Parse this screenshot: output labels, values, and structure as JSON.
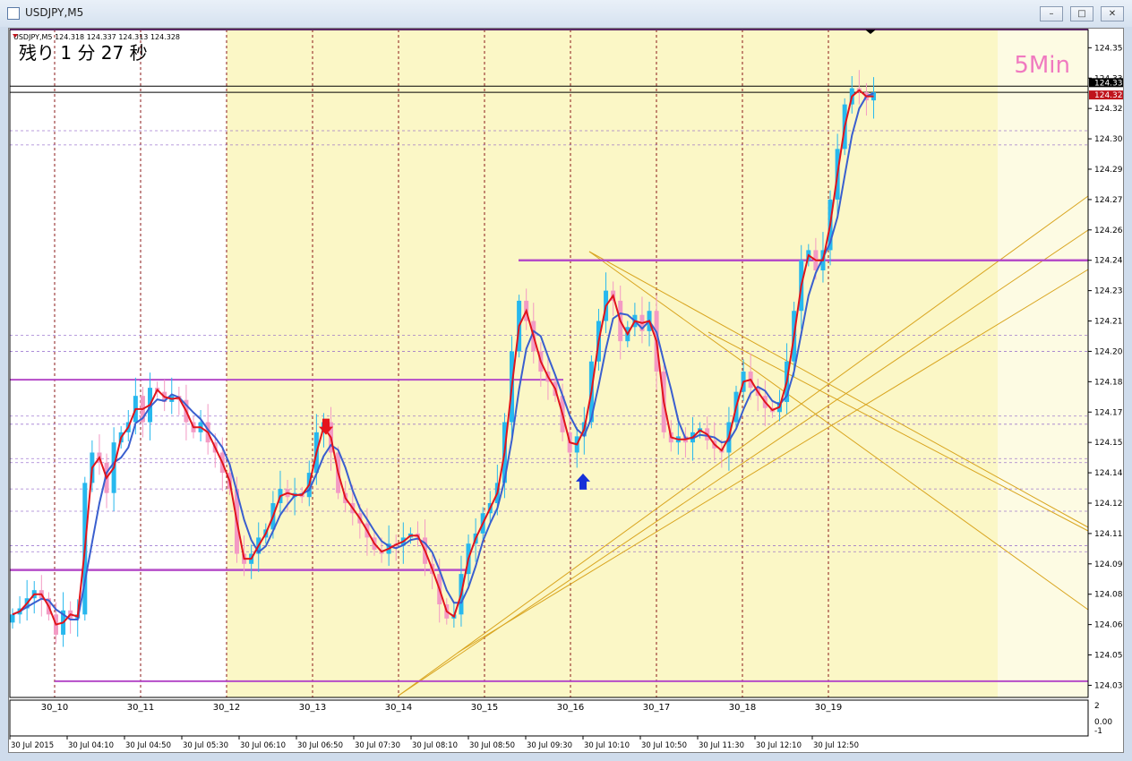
{
  "window": {
    "title": "USDJPY,M5",
    "buttons": [
      "minimize",
      "restore",
      "close"
    ]
  },
  "info_line": "USDJPY,M5  124.318 124.337 124.313 124.328",
  "countdown": "残り 1 分 27 秒",
  "timeframe_label": "5Min",
  "colors": {
    "bg_shade": "#fbf7c6",
    "bull_candle": "#27b8ee",
    "bear_candle": "#f39ac4",
    "ma_fast": "#e0141c",
    "ma_slow": "#3a5fcf",
    "level": "#b54cc8",
    "trend": "#d9a520",
    "grid": "#8b1a1a",
    "price_tag": "#c0141c"
  },
  "chart_data": {
    "type": "candlestick",
    "symbol": "USDJPY",
    "timeframe": "M5",
    "ylim": [
      124.029,
      124.359
    ],
    "y_ticks": [
      "124.350",
      "124.335",
      "124.320",
      "124.305",
      "124.290",
      "124.275",
      "124.260",
      "124.245",
      "124.230",
      "124.215",
      "124.200",
      "124.185",
      "124.170",
      "124.155",
      "124.140",
      "124.125",
      "124.110",
      "124.095",
      "124.080",
      "124.065",
      "124.050",
      "124.035"
    ],
    "price_tags": [
      "124.331",
      "124.328"
    ],
    "day_labels": [
      "30_10",
      "30_11",
      "30_12",
      "30_13",
      "30_14",
      "30_15",
      "30_16",
      "30_17",
      "30_18",
      "30_19"
    ],
    "time_labels": [
      "30 Jul 2015",
      "30 Jul 04:10",
      "30 Jul 04:50",
      "30 Jul 05:30",
      "30 Jul 06:10",
      "30 Jul 06:50",
      "30 Jul 07:30",
      "30 Jul 08:10",
      "30 Jul 08:50",
      "30 Jul 09:30",
      "30 Jul 10:10",
      "30 Jul 10:50",
      "30 Jul 11:30",
      "30 Jul 12:10",
      "30 Jul 12:50"
    ],
    "sub_ticks": [
      "2",
      "0.00",
      "-1"
    ],
    "close_series": [
      124.07,
      124.073,
      124.078,
      124.082,
      124.078,
      124.07,
      124.06,
      124.072,
      124.068,
      124.07,
      124.135,
      124.15,
      124.145,
      124.13,
      124.155,
      124.16,
      124.165,
      124.178,
      124.165,
      124.182,
      124.18,
      124.175,
      124.178,
      124.176,
      124.165,
      124.16,
      124.165,
      124.155,
      124.15,
      124.14,
      124.132,
      124.1,
      124.095,
      124.1,
      124.108,
      124.112,
      124.125,
      124.132,
      124.128,
      124.13,
      124.128,
      124.14,
      124.16,
      124.165,
      124.15,
      124.13,
      124.125,
      124.12,
      124.115,
      124.108,
      124.102,
      124.1,
      124.105,
      124.104,
      124.108,
      124.11,
      124.108,
      124.095,
      124.09,
      124.075,
      124.068,
      124.07,
      124.09,
      124.105,
      124.11,
      124.12,
      124.125,
      124.135,
      124.165,
      124.2,
      124.225,
      124.215,
      124.2,
      124.19,
      124.185,
      124.178,
      124.16,
      124.15,
      124.158,
      124.165,
      124.195,
      124.215,
      124.23,
      124.225,
      124.205,
      124.212,
      124.218,
      124.21,
      124.22,
      124.19,
      124.16,
      124.155,
      124.158,
      124.155,
      124.16,
      124.162,
      124.156,
      124.152,
      124.15,
      124.165,
      124.18,
      124.19,
      124.182,
      124.178,
      124.172,
      124.17,
      124.175,
      124.195,
      124.22,
      124.245,
      124.25,
      124.24,
      124.25,
      124.275,
      124.3,
      124.322,
      124.33,
      124.328,
      124.324,
      124.328
    ],
    "levels": [
      124.359,
      124.245,
      124.186,
      124.092,
      124.037
    ],
    "dashed_levels": [
      124.309,
      124.302,
      124.208,
      124.2,
      124.168,
      124.164,
      124.147,
      124.145,
      124.132,
      124.121,
      124.104,
      124.101
    ],
    "marker_down_price": 124.161,
    "marker_up_price": 124.137
  }
}
